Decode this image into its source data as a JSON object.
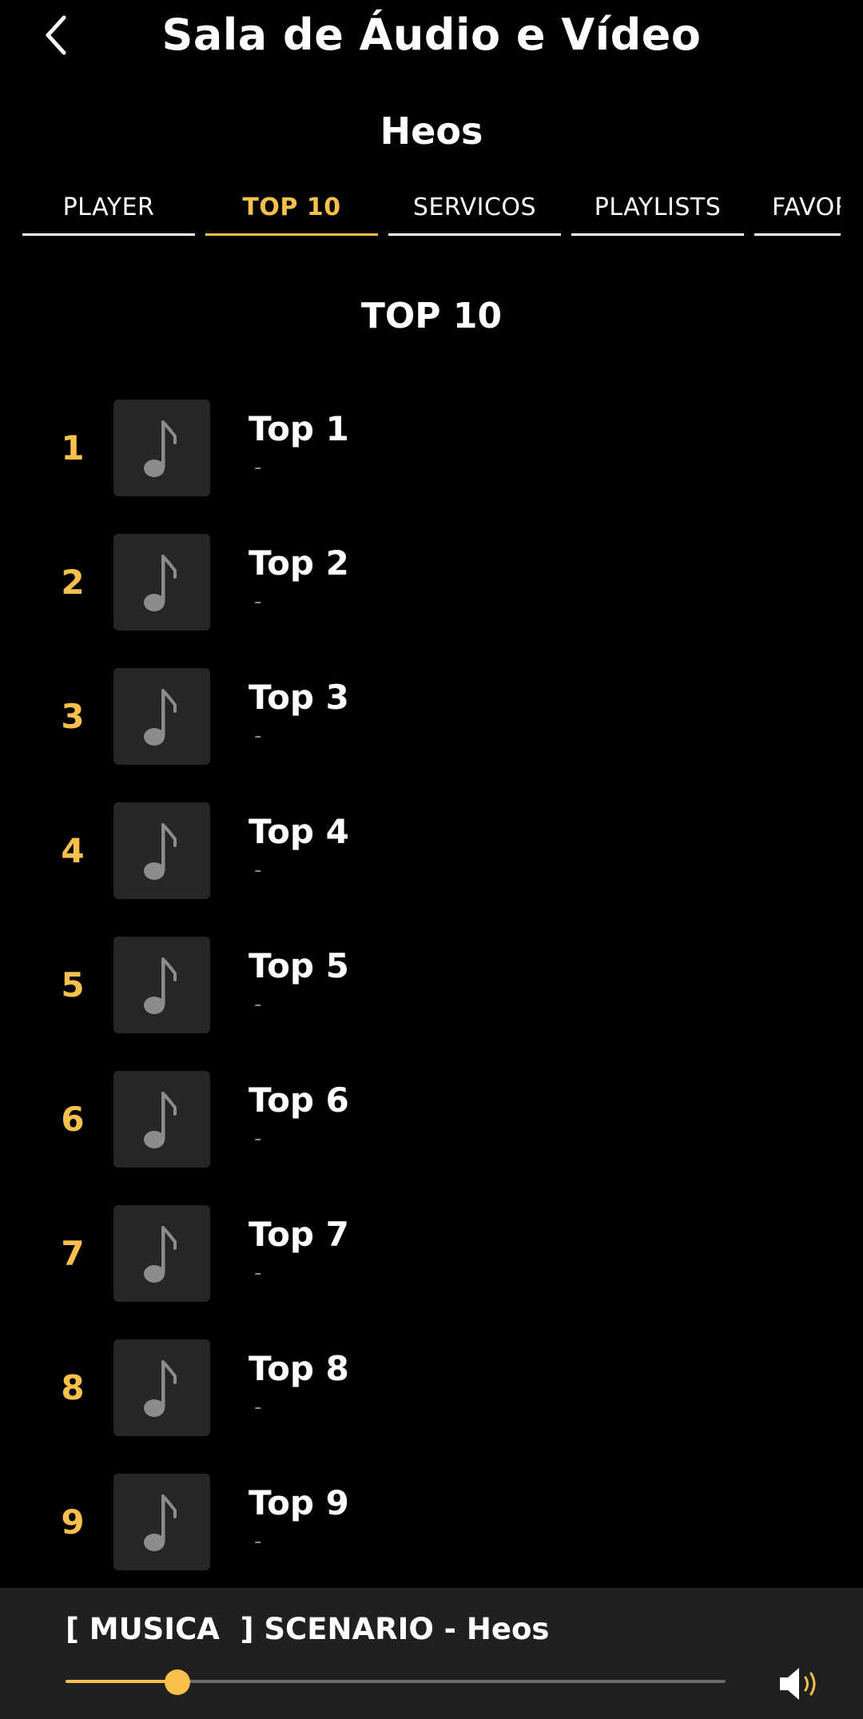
{
  "header": {
    "title": "Sala de Áudio e Vídeo",
    "device": "Heos"
  },
  "tabs": [
    {
      "label": "PLAYER",
      "active": false
    },
    {
      "label": "TOP 10",
      "active": true
    },
    {
      "label": "SERVICOS",
      "active": false
    },
    {
      "label": "PLAYLISTS",
      "active": false
    },
    {
      "label": "FAVORITOS",
      "active": false
    }
  ],
  "section_title": "TOP 10",
  "tracks": [
    {
      "rank": "1",
      "title": "Top 1",
      "subtitle": "-"
    },
    {
      "rank": "2",
      "title": "Top 2",
      "subtitle": "-"
    },
    {
      "rank": "3",
      "title": "Top 3",
      "subtitle": "-"
    },
    {
      "rank": "4",
      "title": "Top 4",
      "subtitle": "-"
    },
    {
      "rank": "5",
      "title": "Top 5",
      "subtitle": "-"
    },
    {
      "rank": "6",
      "title": "Top 6",
      "subtitle": "-"
    },
    {
      "rank": "7",
      "title": "Top 7",
      "subtitle": "-"
    },
    {
      "rank": "8",
      "title": "Top 8",
      "subtitle": "-"
    },
    {
      "rank": "9",
      "title": "Top 9",
      "subtitle": "-"
    }
  ],
  "player": {
    "now_playing": "[ MUSICA  ] SCENARIO - Heos",
    "progress": 0.17
  },
  "icons": {
    "back": "back-chevron-icon",
    "track_thumb": "music-note-icon",
    "volume": "volume-icon"
  },
  "colors": {
    "accent": "#f9c04b",
    "background": "#000000",
    "thumb_bg": "#262626",
    "player_bg": "#202020"
  }
}
